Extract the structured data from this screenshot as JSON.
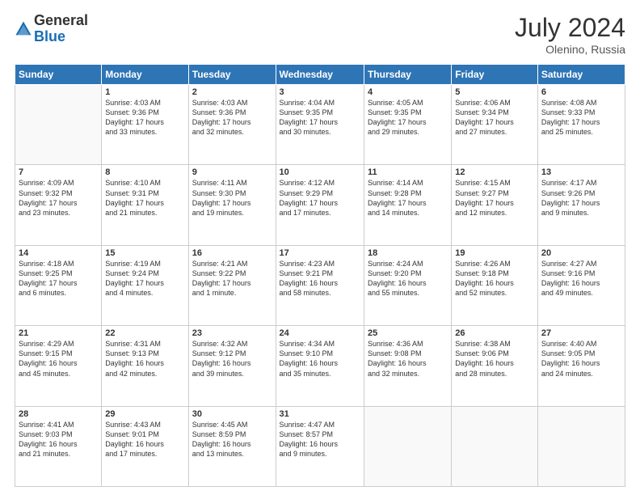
{
  "header": {
    "logo_general": "General",
    "logo_blue": "Blue",
    "month_year": "July 2024",
    "location": "Olenino, Russia"
  },
  "weekdays": [
    "Sunday",
    "Monday",
    "Tuesday",
    "Wednesday",
    "Thursday",
    "Friday",
    "Saturday"
  ],
  "weeks": [
    [
      {
        "day": "",
        "info": ""
      },
      {
        "day": "1",
        "info": "Sunrise: 4:03 AM\nSunset: 9:36 PM\nDaylight: 17 hours\nand 33 minutes."
      },
      {
        "day": "2",
        "info": "Sunrise: 4:03 AM\nSunset: 9:36 PM\nDaylight: 17 hours\nand 32 minutes."
      },
      {
        "day": "3",
        "info": "Sunrise: 4:04 AM\nSunset: 9:35 PM\nDaylight: 17 hours\nand 30 minutes."
      },
      {
        "day": "4",
        "info": "Sunrise: 4:05 AM\nSunset: 9:35 PM\nDaylight: 17 hours\nand 29 minutes."
      },
      {
        "day": "5",
        "info": "Sunrise: 4:06 AM\nSunset: 9:34 PM\nDaylight: 17 hours\nand 27 minutes."
      },
      {
        "day": "6",
        "info": "Sunrise: 4:08 AM\nSunset: 9:33 PM\nDaylight: 17 hours\nand 25 minutes."
      }
    ],
    [
      {
        "day": "7",
        "info": "Sunrise: 4:09 AM\nSunset: 9:32 PM\nDaylight: 17 hours\nand 23 minutes."
      },
      {
        "day": "8",
        "info": "Sunrise: 4:10 AM\nSunset: 9:31 PM\nDaylight: 17 hours\nand 21 minutes."
      },
      {
        "day": "9",
        "info": "Sunrise: 4:11 AM\nSunset: 9:30 PM\nDaylight: 17 hours\nand 19 minutes."
      },
      {
        "day": "10",
        "info": "Sunrise: 4:12 AM\nSunset: 9:29 PM\nDaylight: 17 hours\nand 17 minutes."
      },
      {
        "day": "11",
        "info": "Sunrise: 4:14 AM\nSunset: 9:28 PM\nDaylight: 17 hours\nand 14 minutes."
      },
      {
        "day": "12",
        "info": "Sunrise: 4:15 AM\nSunset: 9:27 PM\nDaylight: 17 hours\nand 12 minutes."
      },
      {
        "day": "13",
        "info": "Sunrise: 4:17 AM\nSunset: 9:26 PM\nDaylight: 17 hours\nand 9 minutes."
      }
    ],
    [
      {
        "day": "14",
        "info": "Sunrise: 4:18 AM\nSunset: 9:25 PM\nDaylight: 17 hours\nand 6 minutes."
      },
      {
        "day": "15",
        "info": "Sunrise: 4:19 AM\nSunset: 9:24 PM\nDaylight: 17 hours\nand 4 minutes."
      },
      {
        "day": "16",
        "info": "Sunrise: 4:21 AM\nSunset: 9:22 PM\nDaylight: 17 hours\nand 1 minute."
      },
      {
        "day": "17",
        "info": "Sunrise: 4:23 AM\nSunset: 9:21 PM\nDaylight: 16 hours\nand 58 minutes."
      },
      {
        "day": "18",
        "info": "Sunrise: 4:24 AM\nSunset: 9:20 PM\nDaylight: 16 hours\nand 55 minutes."
      },
      {
        "day": "19",
        "info": "Sunrise: 4:26 AM\nSunset: 9:18 PM\nDaylight: 16 hours\nand 52 minutes."
      },
      {
        "day": "20",
        "info": "Sunrise: 4:27 AM\nSunset: 9:16 PM\nDaylight: 16 hours\nand 49 minutes."
      }
    ],
    [
      {
        "day": "21",
        "info": "Sunrise: 4:29 AM\nSunset: 9:15 PM\nDaylight: 16 hours\nand 45 minutes."
      },
      {
        "day": "22",
        "info": "Sunrise: 4:31 AM\nSunset: 9:13 PM\nDaylight: 16 hours\nand 42 minutes."
      },
      {
        "day": "23",
        "info": "Sunrise: 4:32 AM\nSunset: 9:12 PM\nDaylight: 16 hours\nand 39 minutes."
      },
      {
        "day": "24",
        "info": "Sunrise: 4:34 AM\nSunset: 9:10 PM\nDaylight: 16 hours\nand 35 minutes."
      },
      {
        "day": "25",
        "info": "Sunrise: 4:36 AM\nSunset: 9:08 PM\nDaylight: 16 hours\nand 32 minutes."
      },
      {
        "day": "26",
        "info": "Sunrise: 4:38 AM\nSunset: 9:06 PM\nDaylight: 16 hours\nand 28 minutes."
      },
      {
        "day": "27",
        "info": "Sunrise: 4:40 AM\nSunset: 9:05 PM\nDaylight: 16 hours\nand 24 minutes."
      }
    ],
    [
      {
        "day": "28",
        "info": "Sunrise: 4:41 AM\nSunset: 9:03 PM\nDaylight: 16 hours\nand 21 minutes."
      },
      {
        "day": "29",
        "info": "Sunrise: 4:43 AM\nSunset: 9:01 PM\nDaylight: 16 hours\nand 17 minutes."
      },
      {
        "day": "30",
        "info": "Sunrise: 4:45 AM\nSunset: 8:59 PM\nDaylight: 16 hours\nand 13 minutes."
      },
      {
        "day": "31",
        "info": "Sunrise: 4:47 AM\nSunset: 8:57 PM\nDaylight: 16 hours\nand 9 minutes."
      },
      {
        "day": "",
        "info": ""
      },
      {
        "day": "",
        "info": ""
      },
      {
        "day": "",
        "info": ""
      }
    ]
  ]
}
